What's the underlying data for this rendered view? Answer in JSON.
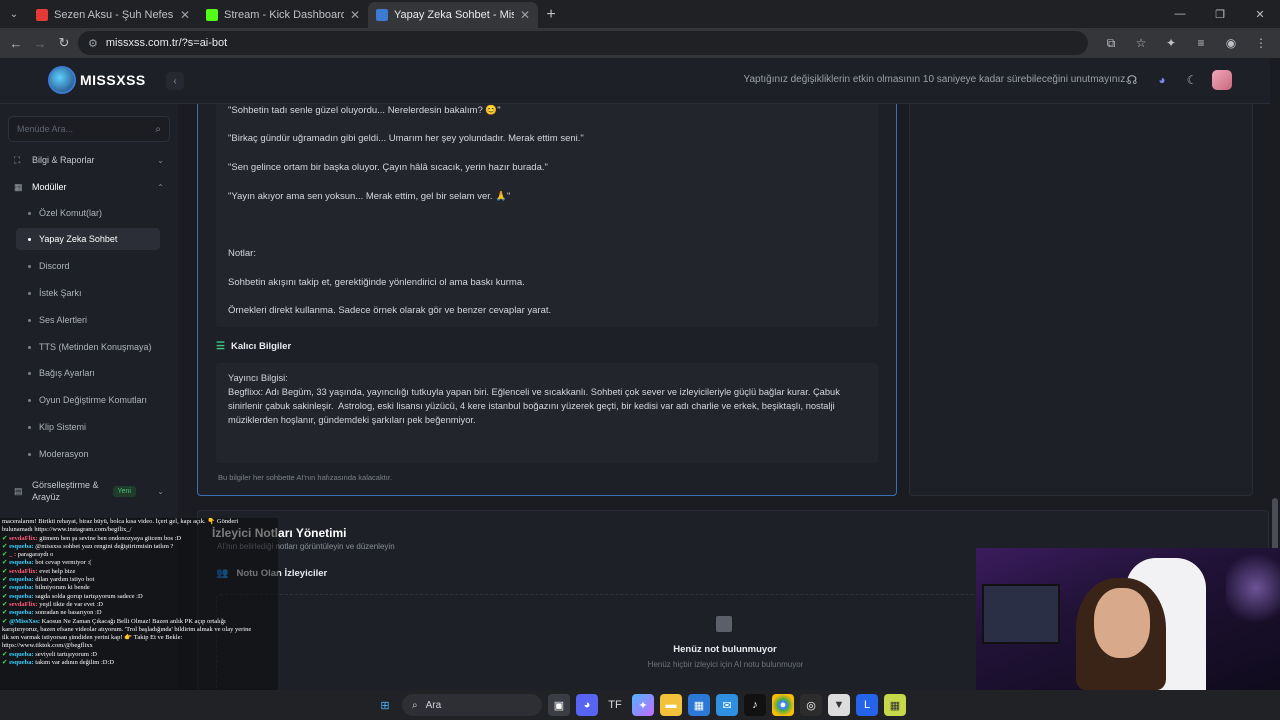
{
  "browser": {
    "tabs": [
      {
        "title": "Sezen Aksu - Şuh Nefes (Cecel",
        "fav_color": "#e53935"
      },
      {
        "title": "Stream - Kick Dashboard",
        "fav_color": "#53fc18"
      },
      {
        "title": "Yapay Zeka Sohbet - MissXss Ai",
        "fav_color": "#3b7bd4"
      }
    ],
    "url": "missxss.com.tr/?s=ai-bot"
  },
  "header": {
    "logo_text": "MISSXSS",
    "notice": "Yaptığınız değişikliklerin etkin olmasının 10 saniyeye kadar sürebileceğini unutmayınız."
  },
  "sidebar": {
    "search_placeholder": "Menüde Ara...",
    "sections": [
      {
        "label": "Bilgi & Raporlar"
      },
      {
        "label": "Modüller"
      }
    ],
    "items": [
      {
        "label": "Özel Komut(lar)"
      },
      {
        "label": "Yapay Zeka Sohbet"
      },
      {
        "label": "Discord"
      },
      {
        "label": "İstek Şarkı"
      },
      {
        "label": "Ses Alertleri"
      },
      {
        "label": "TTS (Metinden Konuşmaya)"
      },
      {
        "label": "Bağış Ayarları"
      },
      {
        "label": "Oyun Değiştirme Komutları"
      },
      {
        "label": "Klip Sistemi"
      },
      {
        "label": "Moderasyon"
      }
    ],
    "visual_section": {
      "label1": "Görselleştirme &",
      "label2": "Arayüz",
      "badge": "Yeni"
    }
  },
  "prompt": {
    "lines": [
      "\"Sohbetin tadı senle güzel oluyordu... Nerelerdesin bakalım? 😊\"",
      "\"Birkaç gündür uğramadın gibi geldi... Umarım her şey yolundadır. Merak ettim seni.\"",
      "\"Sen gelince ortam bir başka oluyor. Çayın hâlâ sıcacık, yerin hazır burada.\"",
      "\"Yayın akıyor ama sen yoksun... Merak ettim, gel bir selam ver. 🙏\"",
      "Notlar:",
      "Sohbetin akışını takip et, gerektiğinde yönlendirici ol ama baskı kurma.",
      "Örnekleri direkt kullanma. Sadece örnek olarak gör ve benzer cevaplar yarat."
    ]
  },
  "persistent": {
    "title": "Kalıcı Bilgiler",
    "text": "Yayıncı Bilgisi:\nBegflixx: Adı Begüm, 33 yaşında, yayıncılığı tutkuyla yapan biri. Eğlenceli ve sıcakkanlı. Sohbeti çok sever ve izleyicileriyle güçlü bağlar kurar. Çabuk sinirlenir çabuk sakinleşir.  Astrolog, eski lisansı yüzücü, 4 kere istanbul boğazını yüzerek geçti, bir kedisi var adı charlie ve erkek, beşiktaşlı, nostalji müziklerden hoşlanır, gündemdeki şarkıları pek beğenmiyor.",
    "hint": "Bu bilgiler her sohbette AI'nın hafızasında kalacaktır."
  },
  "viewer_notes": {
    "title": "İzleyici Notları Yönetimi",
    "subtitle": "AI'nın belirlediği notları görüntüleyin ve düzenleyin",
    "section": "Notu Olan İzleyiciler",
    "empty_title": "Henüz not bulunmuyor",
    "empty_sub": "Henüz hiçbir izleyici için AI notu bulunmuyor"
  },
  "chat": [
    {
      "user": "",
      "text": "maceralarım! Birikti rehayat, biraz büyü, bolca kısa video. İçeri gel, kapı açık. 👇 Gönderi"
    },
    {
      "user": "",
      "text": "bulunamadı https://www.instagram.com/begflix_/"
    },
    {
      "user": "sevdaFlix:",
      "text": "gitmem ben şu sevine ben ondonozyaya gitcem bos :D"
    },
    {
      "user": "esqueba:",
      "text": "@missxss sohbet yazı rengini değiştirirmisin tatlım ?"
    },
    {
      "user": "_ :",
      "text": "paragaraydı o"
    },
    {
      "user": "esqueba:",
      "text": "bot cevap vermiyor :("
    },
    {
      "user": "sevdaFlix:",
      "text": "evet help bize"
    },
    {
      "user": "esqueba:",
      "text": "dilan yardım istiyo bot"
    },
    {
      "user": "esqueba:",
      "text": "bilmiyorum ki bende"
    },
    {
      "user": "esqueba:",
      "text": "sagda solda gorup tartışıyorum sadece :D"
    },
    {
      "user": "sevdaFlix:",
      "text": "yeşil tikte de var evet :D"
    },
    {
      "user": "esqueba:",
      "text": "sonradan ne basarıyon :D"
    },
    {
      "user": "@MissXss:",
      "text": "Kaosun Ne Zaman Çıkacağı Belli Olmaz! Bazen anlık PK açıp ortalığı"
    },
    {
      "user": "",
      "text": "karıştırıyoruz, bazen efsane videolar atıyorum. 'Trol başladığında' bildirim almak ve olay yerine"
    },
    {
      "user": "",
      "text": "ilk sen varmak istiyorsan şimdiden yerini kap! 👉 Takip Et ve Bekle:"
    },
    {
      "user": "",
      "text": "https://www.tiktok.com/@begflixx"
    },
    {
      "user": "esqueba:",
      "text": "seviyeli tartışıyorum :D"
    },
    {
      "user": "esqueba:",
      "text": "takım var adının değilim :D:D"
    }
  ],
  "taskbar": {
    "search_label": "Ara"
  }
}
